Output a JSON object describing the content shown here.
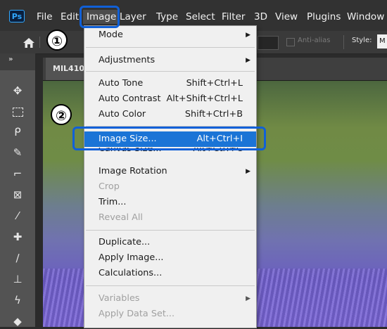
{
  "app": {
    "logo": "Ps"
  },
  "menubar": {
    "items": [
      "File",
      "Edit",
      "Image",
      "Layer",
      "Type",
      "Select",
      "Filter",
      "3D",
      "View",
      "Plugins",
      "Window"
    ]
  },
  "options": {
    "anti_alias": "Anti-alias",
    "style_label": "Style:",
    "style_value": "M"
  },
  "document": {
    "tab_title": "MIL410"
  },
  "callouts": {
    "one": "①",
    "two": "②"
  },
  "image_menu": {
    "mode": "Mode",
    "adjustments": "Adjustments",
    "auto_tone": "Auto Tone",
    "auto_tone_sc": "Shift+Ctrl+L",
    "auto_contrast": "Auto Contrast",
    "auto_contrast_sc": "Alt+Shift+Ctrl+L",
    "auto_color": "Auto Color",
    "auto_color_sc": "Shift+Ctrl+B",
    "image_size": "Image Size...",
    "image_size_sc": "Alt+Ctrl+I",
    "canvas_size": "Canvas Size...",
    "canvas_size_sc": "Alt+Ctrl+C",
    "image_rotation": "Image Rotation",
    "crop": "Crop",
    "trim": "Trim...",
    "reveal_all": "Reveal All",
    "duplicate": "Duplicate...",
    "apply_image": "Apply Image...",
    "calculations": "Calculations...",
    "variables": "Variables",
    "apply_data_set": "Apply Data Set..."
  },
  "icons": {
    "home": "home-icon",
    "move": "move-icon",
    "marquee": "marquee-icon",
    "lasso": "lasso-icon",
    "quick_select": "quick-select-icon",
    "crop": "crop-icon",
    "frame": "frame-icon",
    "eyedropper": "eyedropper-icon",
    "healing": "healing-brush-icon",
    "brush": "brush-icon",
    "stamp": "clone-stamp-icon",
    "history": "history-brush-icon"
  }
}
